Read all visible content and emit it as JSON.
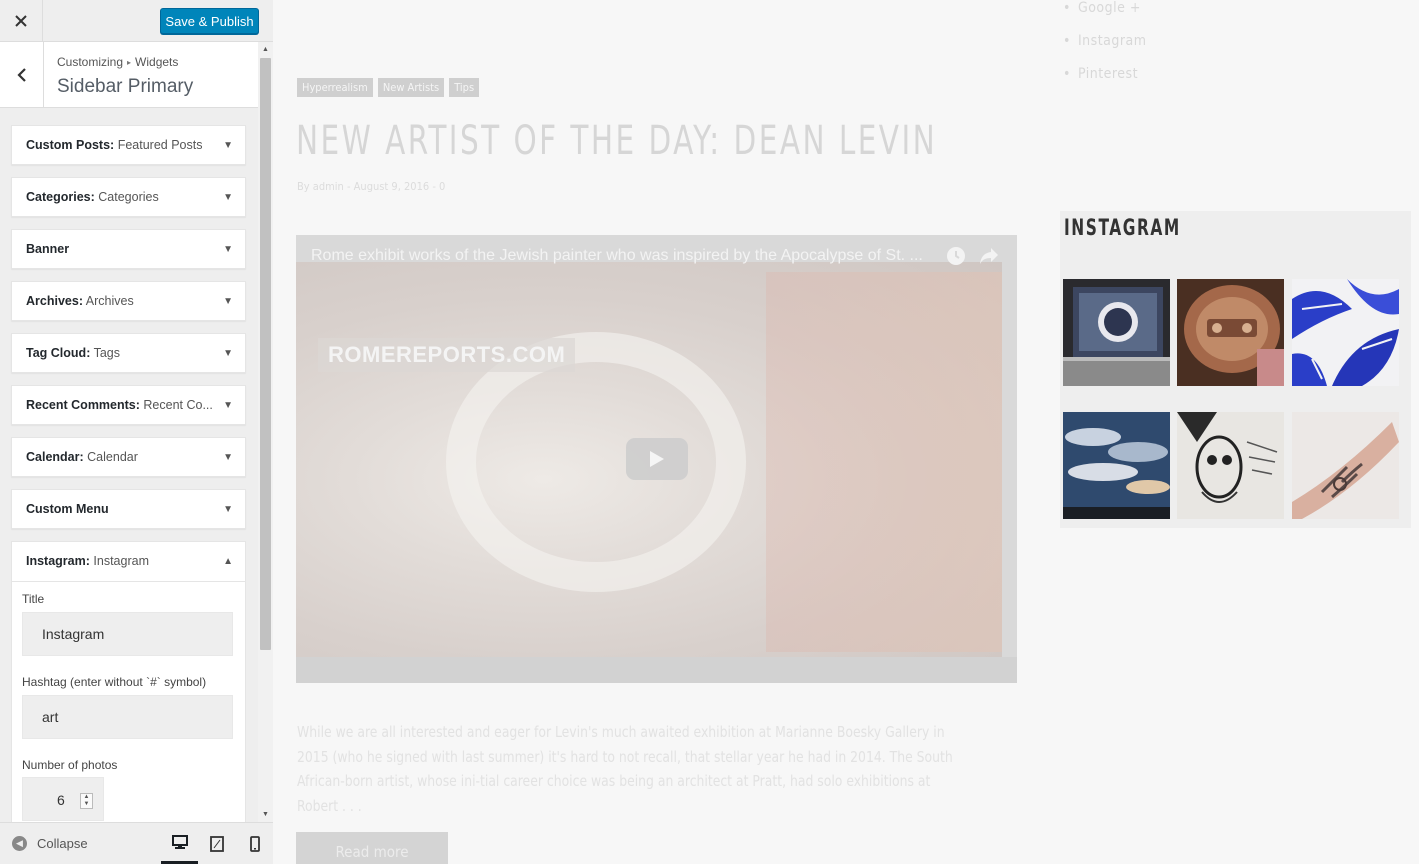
{
  "topbar": {
    "close_icon": "close-icon",
    "save_label": "Save & Publish"
  },
  "section": {
    "crumb_root": "Customizing",
    "crumb_child": "Widgets",
    "title": "Sidebar Primary"
  },
  "widgets": [
    {
      "type": "Custom Posts",
      "name": "Featured Posts"
    },
    {
      "type": "Categories",
      "name": "Categories"
    },
    {
      "type": "Banner",
      "name": ""
    },
    {
      "type": "Archives",
      "name": "Archives"
    },
    {
      "type": "Tag Cloud",
      "name": "Tags"
    },
    {
      "type": "Recent Comments",
      "name": "Recent Co..."
    },
    {
      "type": "Calendar",
      "name": "Calendar"
    },
    {
      "type": "Custom Menu",
      "name": ""
    }
  ],
  "open_widget": {
    "type": "Instagram",
    "name": "Instagram",
    "title_label": "Title",
    "title_value": "Instagram",
    "hashtag_label": "Hashtag (enter without `#` symbol)",
    "hashtag_value": "art",
    "photos_label": "Number of photos",
    "photos_value": "6"
  },
  "footer": {
    "collapse_label": "Collapse",
    "devices": [
      "desktop-icon",
      "tablet-icon",
      "mobile-icon"
    ],
    "active_device": "desktop"
  },
  "preview": {
    "social_links": [
      "Google +",
      "Instagram",
      "Pinterest"
    ],
    "tags": [
      "Hyperrealism",
      "New Artists",
      "Tips"
    ],
    "post_title": "NEW ARTIST OF THE DAY: DEAN LEVIN",
    "post_meta": "By admin - August 9, 2016 - 0",
    "video": {
      "title": "Rome exhibit works of the Jewish painter who was inspired by the Apocalypse of St. ...",
      "watermark": "ROMEREPORTS.COM"
    },
    "excerpt": "While we are all interested and eager for Levin's much awaited exhibition at Marianne Boesky Gallery in 2015 (who he signed with last summer) it's hard to not recall, that stellar year he had in 2014. The South African-born artist, whose ini-tial career choice was being an architect at Pratt, had solo exhibitions at Robert . . .",
    "read_more": "Read more",
    "instagram": {
      "title": "INSTAGRAM",
      "photos": [
        "laptop-photo",
        "bronze-machine-photo",
        "blue-leaves-photo",
        "cloudy-sky-photo",
        "ink-sketch-photo",
        "tattooed-arm-photo"
      ]
    }
  }
}
